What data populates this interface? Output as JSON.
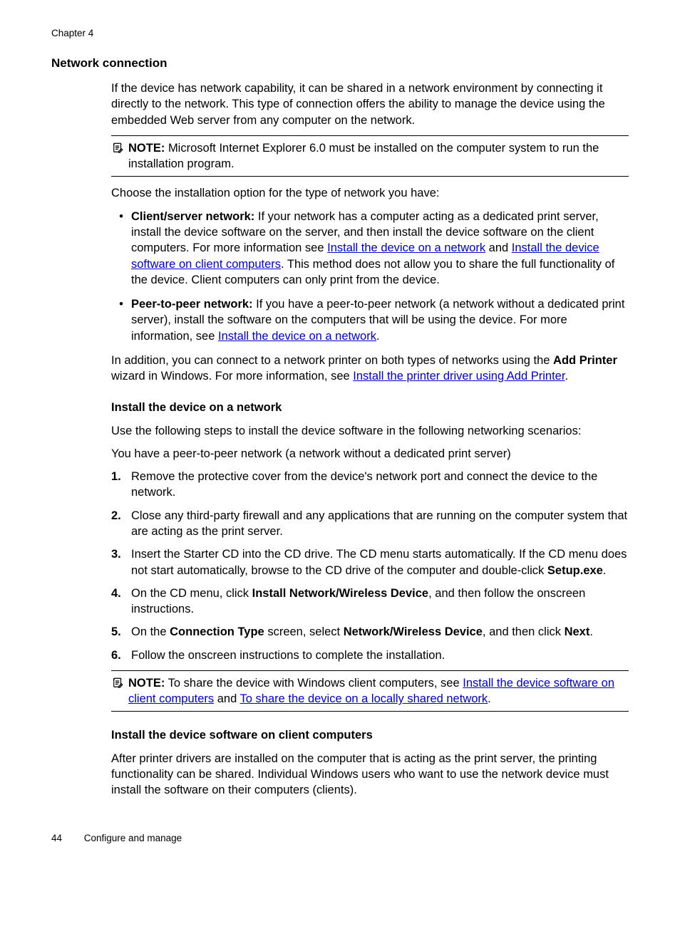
{
  "header": {
    "chapter": "Chapter 4"
  },
  "section": {
    "title": "Network connection"
  },
  "intro": "If the device has network capability, it can be shared in a network environment by connecting it directly to the network. This type of connection offers the ability to manage the device using the embedded Web server from any computer on the network.",
  "note1": {
    "label": "NOTE:",
    "text": "Microsoft Internet Explorer 6.0 must be installed on the computer system to run the installation program."
  },
  "choose": "Choose the installation option for the type of network you have:",
  "bullets": {
    "b1": {
      "lead": "Client/server network:",
      "pre": " If your network has a computer acting as a dedicated print server, install the device software on the server, and then install the device software on the client computers. For more information see ",
      "link1": "Install the device on a network",
      "mid1": " and ",
      "link2": "Install the device software on client computers",
      "post": ". This method does not allow you to share the full functionality of the device. Client computers can only print from the device."
    },
    "b2": {
      "lead": "Peer-to-peer network:",
      "pre": " If you have a peer-to-peer network (a network without a dedicated print server), install the software on the computers that will be using the device. For more information, see ",
      "link": "Install the device on a network",
      "post": "."
    }
  },
  "addprinter": {
    "pre": "In addition, you can connect to a network printer on both types of networks using the ",
    "bold1": "Add Printer",
    "mid": " wizard in Windows. For more information, see ",
    "link": "Install the printer driver using Add Printer",
    "post": "."
  },
  "install_network": {
    "heading": "Install the device on a network",
    "p1": "Use the following steps to install the device software in the following networking scenarios:",
    "p2": "You have a peer-to-peer network (a network without a dedicated print server)",
    "steps": {
      "s1": "Remove the protective cover from the device's network port and connect the device to the network.",
      "s2": "Close any third-party firewall and any applications that are running on the computer system that are acting as the print server.",
      "s3": {
        "pre": "Insert the Starter CD into the CD drive. The CD menu starts automatically. If the CD menu does not start automatically, browse to the CD drive of the computer and double-click ",
        "bold": "Setup.exe",
        "post": "."
      },
      "s4": {
        "pre": "On the CD menu, click ",
        "bold": "Install Network/Wireless Device",
        "post": ", and then follow the onscreen instructions."
      },
      "s5": {
        "pre": "On the ",
        "bold1": "Connection Type",
        "mid": " screen, select ",
        "bold2": "Network/Wireless Device",
        "post": ", and then click ",
        "bold3": "Next",
        "end": "."
      },
      "s6": "Follow the onscreen instructions to complete the installation."
    }
  },
  "note2": {
    "label": "NOTE:",
    "pre": "To share the device with Windows client computers, see ",
    "link1": "Install the device software on client computers",
    "mid": " and ",
    "link2": "To share the device on a locally shared network",
    "post": "."
  },
  "install_client": {
    "heading": "Install the device software on client computers",
    "p1": "After printer drivers are installed on the computer that is acting as the print server, the printing functionality can be shared. Individual Windows users who want to use the network device must install the software on their computers (clients)."
  },
  "footer": {
    "page": "44",
    "title": "Configure and manage"
  }
}
